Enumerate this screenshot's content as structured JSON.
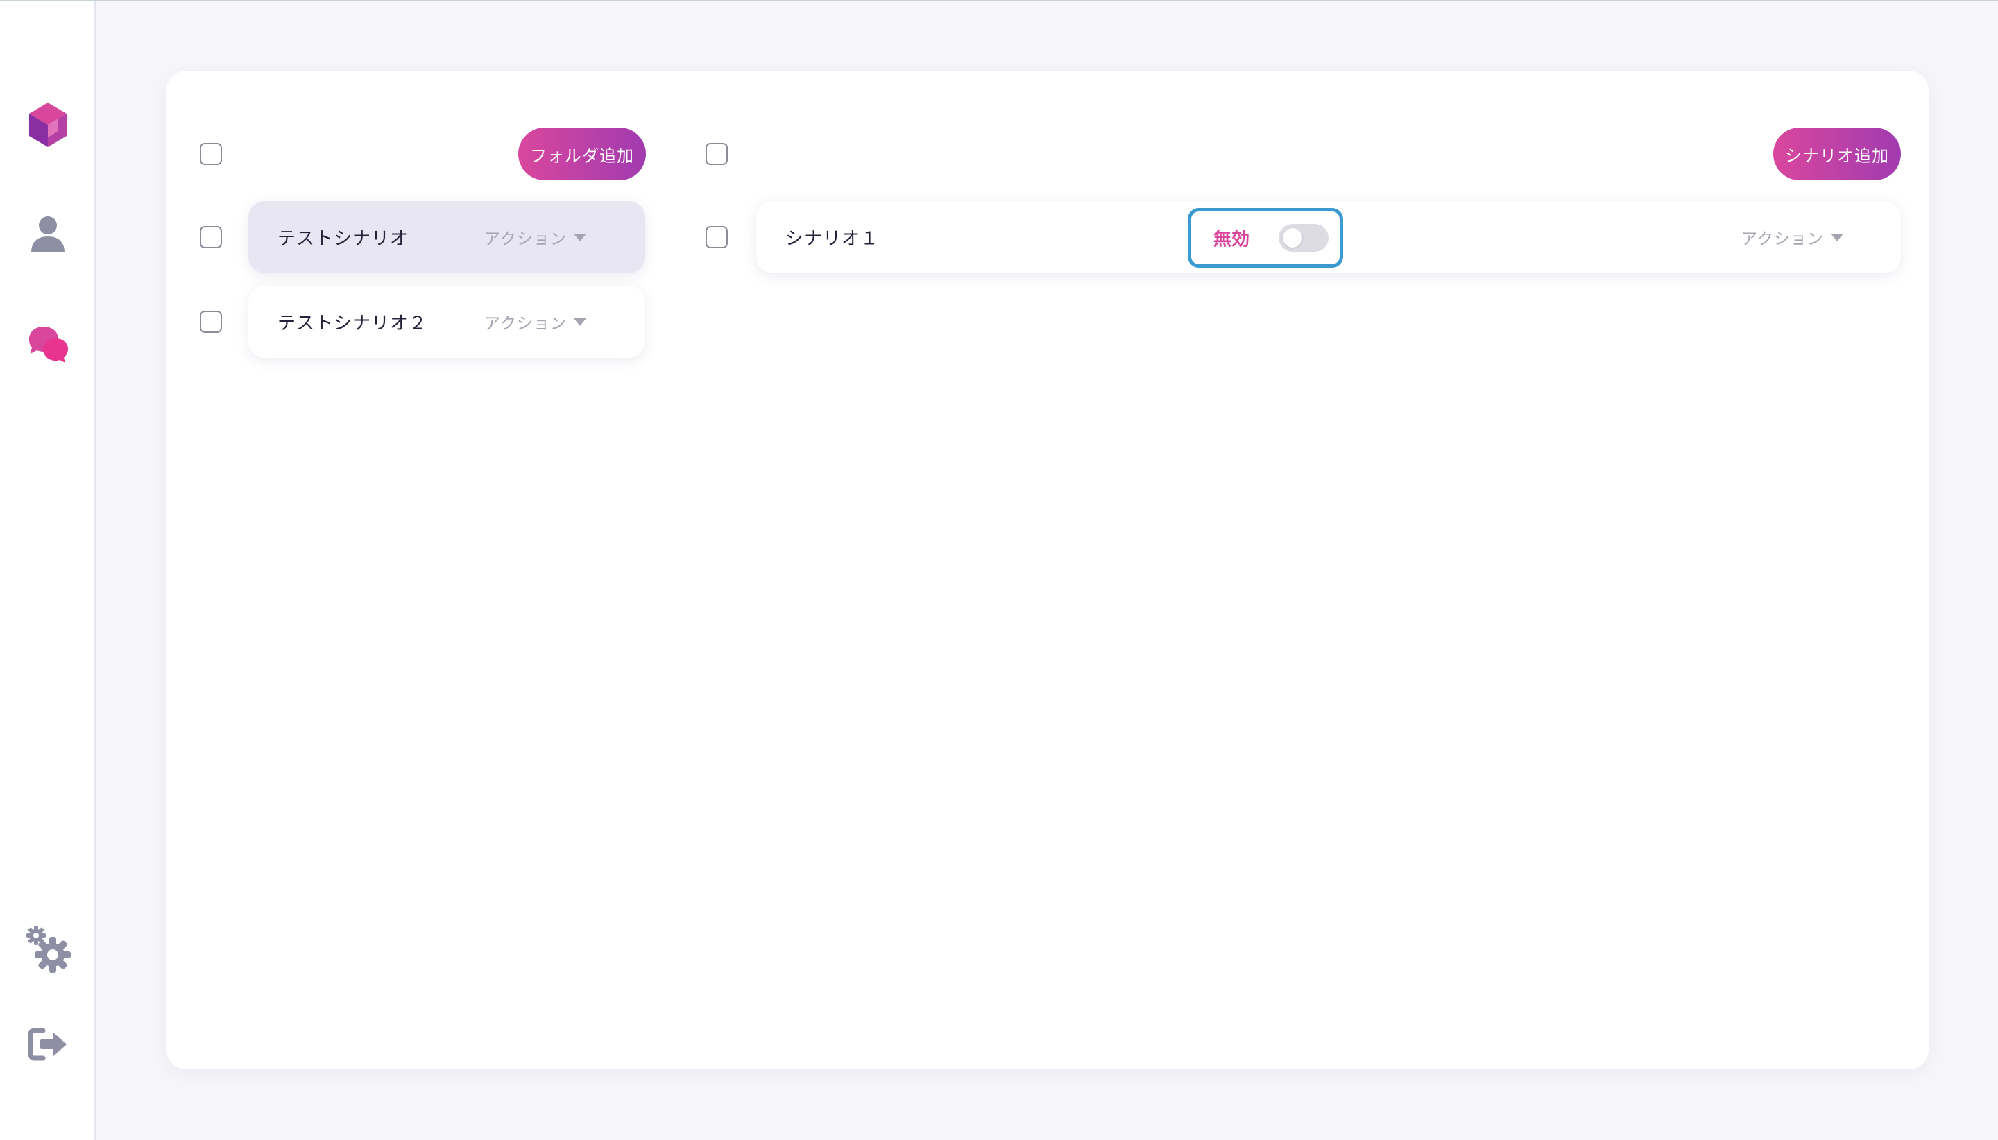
{
  "sidebar": {
    "items": [
      {
        "icon": "logo-cube-icon"
      },
      {
        "icon": "user-icon"
      },
      {
        "icon": "chat-bubbles-icon"
      },
      {
        "icon": "gears-icon"
      },
      {
        "icon": "logout-icon"
      }
    ]
  },
  "folders": {
    "add_button_label": "フォルダ追加",
    "items": [
      {
        "title": "テストシナリオ",
        "action_label": "アクション",
        "selected": true
      },
      {
        "title": "テストシナリオ２",
        "action_label": "アクション",
        "selected": false
      }
    ]
  },
  "scenarios": {
    "add_button_label": "シナリオ追加",
    "items": [
      {
        "title": "シナリオ１",
        "status_label": "無効",
        "enabled": false,
        "action_label": "アクション"
      }
    ]
  },
  "colors": {
    "accent_pink": "#d9479d",
    "accent_purple": "#a13bb0",
    "highlight_blue": "#3b9bd0",
    "selected_row_bg": "#e9e6f4"
  }
}
